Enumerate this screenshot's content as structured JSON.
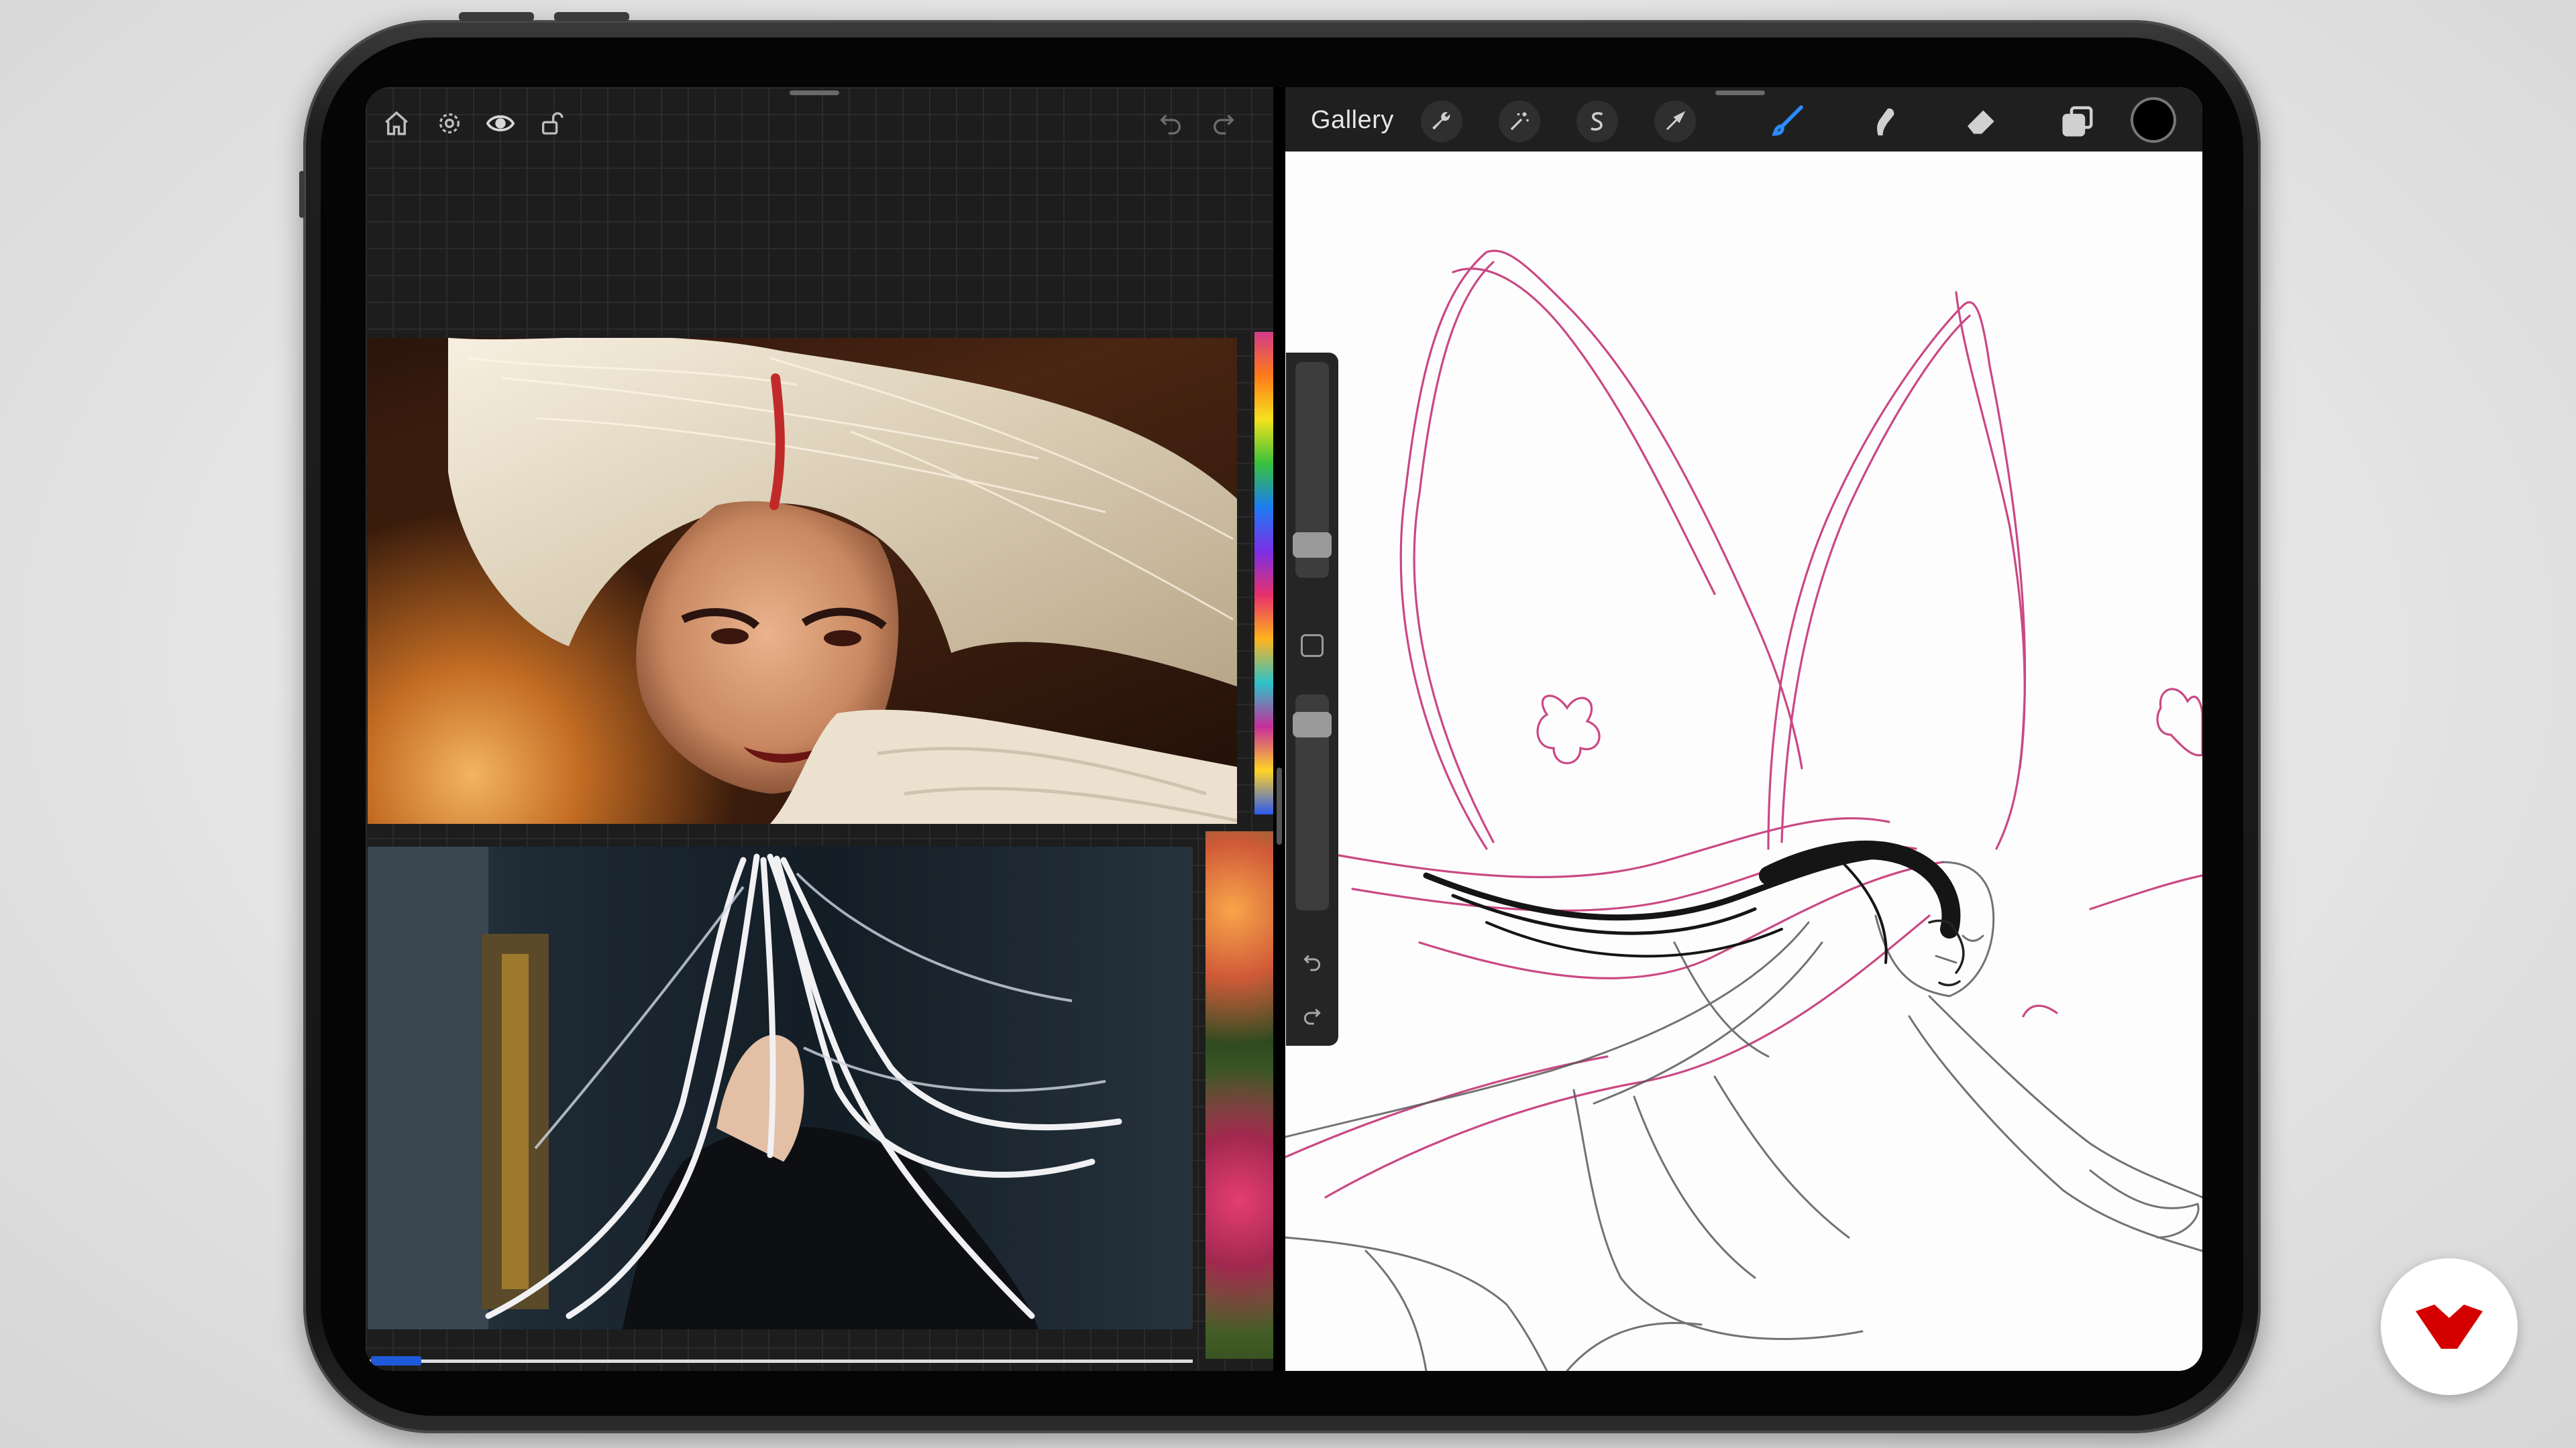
{
  "left_app": {
    "toolbar": {
      "home": "home-icon",
      "settings": "settings-icon",
      "view": "eye-icon",
      "lock": "lock-icon",
      "undo": "undo-icon",
      "redo": "redo-icon"
    },
    "references": [
      {
        "subject": "photo-1"
      },
      {
        "subject": "photo-2"
      }
    ]
  },
  "procreate": {
    "gallery_label": "Gallery",
    "tools": [
      "wrench-icon",
      "magic-wand-icon",
      "selection-icon",
      "transform-arrow-icon",
      "brush-icon",
      "smudge-icon",
      "eraser-icon",
      "layers-icon"
    ],
    "active_tool": "brush-icon",
    "current_color": "#000000",
    "sidebar": {
      "brush_size": 0.72,
      "opacity": 0.27
    },
    "colors": {
      "accent": "#2b8cff",
      "sketch_pink": "#c2296f",
      "sketch_gray": "#5a5a5a"
    }
  },
  "watermark": {
    "logo": "domestika-logo",
    "color": "#d40000"
  }
}
